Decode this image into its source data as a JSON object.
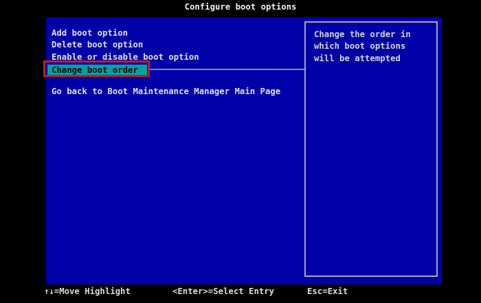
{
  "title": "Configure boot options",
  "colors": {
    "screen_bg": "#000000",
    "panel_bg": "#0000a8",
    "highlight_bg": "#00a3a3",
    "highlight_text": "#000000",
    "menu_text": "#e2e2d8",
    "help_border": "#a7a7a7",
    "annotation_red": "#c41e1e",
    "leader_line": "#8585ad"
  },
  "menu": {
    "items": [
      {
        "label": "Add boot option",
        "highlighted": false
      },
      {
        "label": "Delete boot option",
        "highlighted": false
      },
      {
        "label": "Enable or disable boot option",
        "highlighted": false
      },
      {
        "label": "Change boot order",
        "highlighted": true
      },
      {
        "label": "Go back to Boot Maintenance Manager Main Page",
        "highlighted": false
      }
    ]
  },
  "help_panel": {
    "text": "Change the order in\nwhich boot options\nwill be attempted"
  },
  "footer": {
    "move_hint": "↑↓=Move Highlight",
    "select_hint": "<Enter>=Select Entry",
    "exit_hint": "Esc=Exit"
  }
}
